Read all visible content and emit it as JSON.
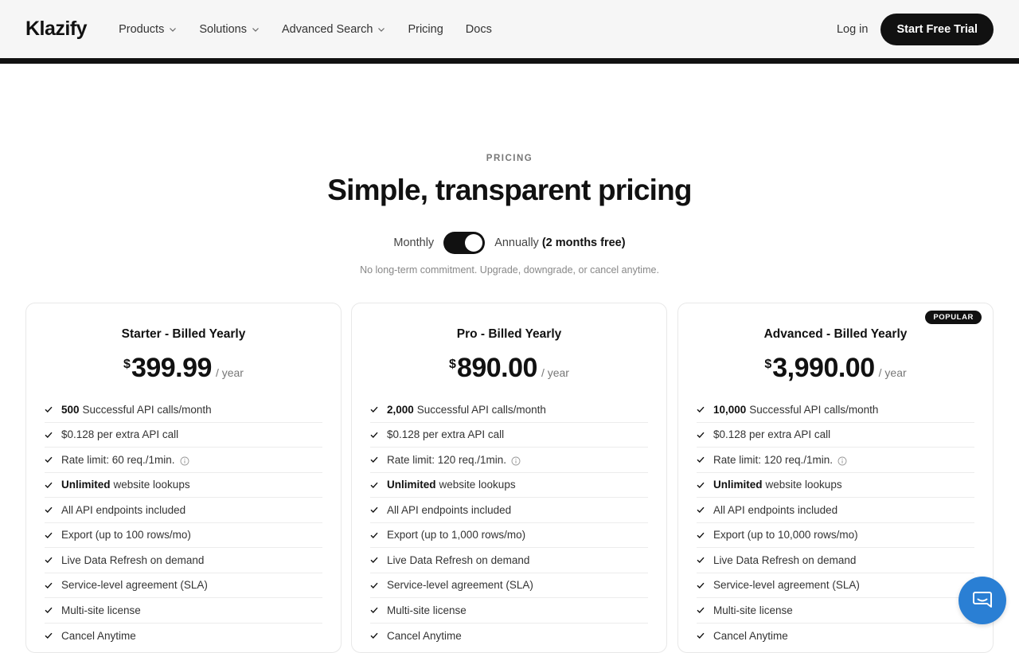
{
  "header": {
    "logo": "Klazify",
    "nav": [
      {
        "label": "Products",
        "dropdown": true
      },
      {
        "label": "Solutions",
        "dropdown": true
      },
      {
        "label": "Advanced Search",
        "dropdown": true
      },
      {
        "label": "Pricing",
        "dropdown": false
      },
      {
        "label": "Docs",
        "dropdown": false
      }
    ],
    "login": "Log in",
    "cta": "Start Free Trial"
  },
  "hero": {
    "eyebrow": "PRICING",
    "title": "Simple, transparent pricing",
    "monthly": "Monthly",
    "annually": "Annually",
    "annually_bonus": "(2 months free)",
    "toggle_state": "annually",
    "note": "No long-term commitment. Upgrade, downgrade, or cancel anytime."
  },
  "plans": [
    {
      "title": "Starter - Billed Yearly",
      "currency": "$",
      "amount": "399.99",
      "period": "/ year",
      "popular": false,
      "features": [
        {
          "bold": "500",
          "text": "Successful API calls/month"
        },
        {
          "bold": "",
          "text": "$0.128 per extra API call"
        },
        {
          "bold": "",
          "text": "Rate limit: 60 req./1min.",
          "info": true
        },
        {
          "bold": "Unlimited",
          "text": "website lookups"
        },
        {
          "bold": "",
          "text": "All API endpoints included"
        },
        {
          "bold": "",
          "text": "Export (up to 100 rows/mo)"
        },
        {
          "bold": "",
          "text": "Live Data Refresh on demand"
        },
        {
          "bold": "",
          "text": "Service-level agreement (SLA)"
        },
        {
          "bold": "",
          "text": "Multi-site license"
        },
        {
          "bold": "",
          "text": "Cancel Anytime"
        }
      ]
    },
    {
      "title": "Pro - Billed Yearly",
      "currency": "$",
      "amount": "890.00",
      "period": "/ year",
      "popular": false,
      "features": [
        {
          "bold": "2,000",
          "text": "Successful API calls/month"
        },
        {
          "bold": "",
          "text": "$0.128 per extra API call"
        },
        {
          "bold": "",
          "text": "Rate limit: 120 req./1min.",
          "info": true
        },
        {
          "bold": "Unlimited",
          "text": "website lookups"
        },
        {
          "bold": "",
          "text": "All API endpoints included"
        },
        {
          "bold": "",
          "text": "Export (up to 1,000 rows/mo)"
        },
        {
          "bold": "",
          "text": "Live Data Refresh on demand"
        },
        {
          "bold": "",
          "text": "Service-level agreement (SLA)"
        },
        {
          "bold": "",
          "text": "Multi-site license"
        },
        {
          "bold": "",
          "text": "Cancel Anytime"
        }
      ]
    },
    {
      "title": "Advanced - Billed Yearly",
      "currency": "$",
      "amount": "3,990.00",
      "period": "/ year",
      "popular": true,
      "badge": "POPULAR",
      "features": [
        {
          "bold": "10,000",
          "text": "Successful API calls/month"
        },
        {
          "bold": "",
          "text": "$0.128 per extra API call"
        },
        {
          "bold": "",
          "text": "Rate limit: 120 req./1min.",
          "info": true
        },
        {
          "bold": "Unlimited",
          "text": "website lookups"
        },
        {
          "bold": "",
          "text": "All API endpoints included"
        },
        {
          "bold": "",
          "text": "Export (up to 10,000 rows/mo)"
        },
        {
          "bold": "",
          "text": "Live Data Refresh on demand"
        },
        {
          "bold": "",
          "text": "Service-level agreement (SLA)"
        },
        {
          "bold": "",
          "text": "Multi-site license"
        },
        {
          "bold": "",
          "text": "Cancel Anytime"
        }
      ]
    }
  ],
  "colors": {
    "header_bg": "#f6f6f6",
    "primary": "#111111",
    "chat_button": "#2a7fd4"
  },
  "icons": {
    "chevron": "chevron-down-icon",
    "check": "check-icon",
    "info": "info-icon",
    "chat": "chat-icon"
  }
}
